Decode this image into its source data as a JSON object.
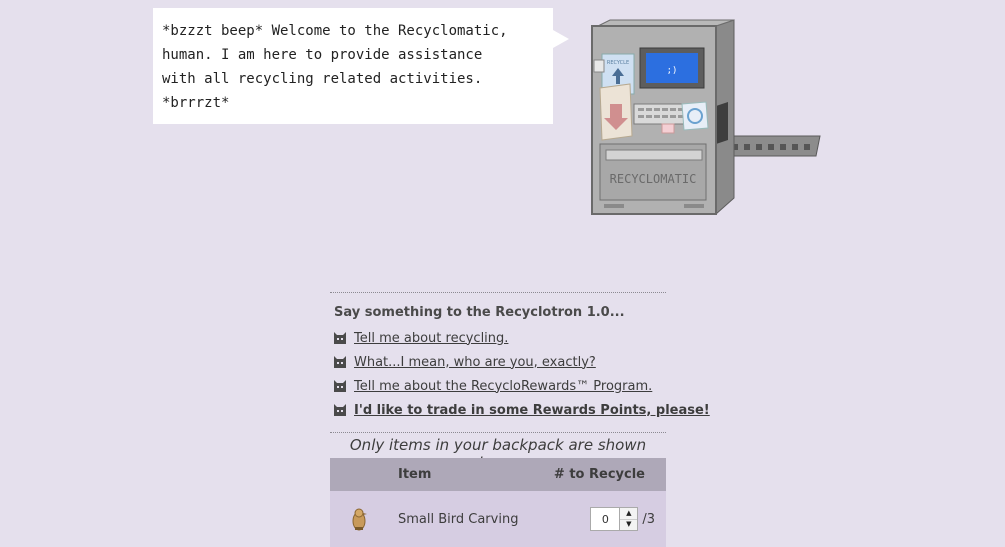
{
  "bubble": {
    "text": "*bzzzt beep* Welcome to the Recyclomatic,\nhuman. I am here to provide assistance\nwith all recycling related activities.\n*brrrzt*"
  },
  "machine": {
    "label": "RECYCLOMATIC",
    "screen_face": ";)",
    "poster_text": "RECYCLE"
  },
  "dialog": {
    "title": "Say something to the Recyclotron 1.0...",
    "options": [
      {
        "label": "Tell me about recycling.",
        "bold": false
      },
      {
        "label": "What...I mean, who are you, exactly?",
        "bold": false
      },
      {
        "label": "Tell me about the RecycloRewards™ Program.",
        "bold": false
      },
      {
        "label": "I'd like to trade in some Rewards Points, please!",
        "bold": true
      }
    ]
  },
  "backpack_note": "Only items in your backpack are shown here.",
  "table": {
    "headers": {
      "item": "Item",
      "count": "# to Recycle"
    },
    "rows": [
      {
        "name": "Small Bird Carving",
        "value": "0",
        "max": "/3",
        "icon": "bird-carving-icon"
      }
    ]
  },
  "colors": {
    "background": "#e5e0ed",
    "table_header": "#aea8b8",
    "table_row": "#d6cde2"
  }
}
